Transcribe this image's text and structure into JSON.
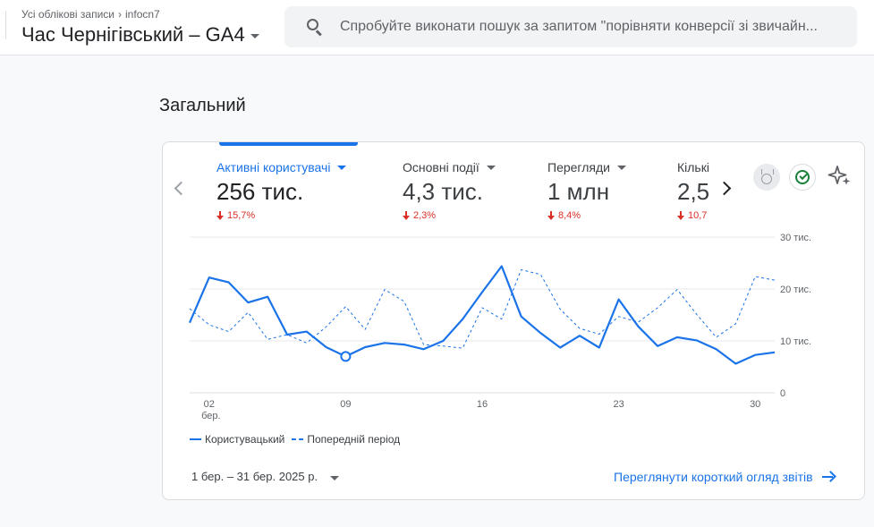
{
  "header": {
    "breadcrumb": [
      "Усі облікові записи",
      "infocn7"
    ],
    "property_name": "Час Чернігівський – GA4",
    "search_placeholder": "Спробуйте виконати пошук за запитом \"порівняти конверсії зі звичайн..."
  },
  "section_title": "Загальний",
  "metrics": [
    {
      "label": "Активні користувачі",
      "value": "256 тис.",
      "delta": "15,7%",
      "active": true
    },
    {
      "label": "Основні події",
      "value": "4,3 тис.",
      "delta": "2,3%",
      "active": false
    },
    {
      "label": "Перегляди",
      "value": "1 млн",
      "delta": "8,4%",
      "active": false
    },
    {
      "label": "Кількі",
      "value": "2,5",
      "delta": "10,7",
      "active": false
    }
  ],
  "icons": {
    "medal": "medal-icon",
    "check": "check-circle-icon",
    "sparkle": "sparkle-icon"
  },
  "colors": {
    "accent": "#1a73e8",
    "negative": "#d93025",
    "positive": "#188038"
  },
  "legend": {
    "current": "Користувацький",
    "previous": "Попередній період"
  },
  "date_range": "1 бер. – 31 бер. 2025 р.",
  "view_link": "Переглянути короткий огляд звітів",
  "chart_data": {
    "type": "line",
    "x": [
      1,
      2,
      3,
      4,
      5,
      6,
      7,
      8,
      9,
      10,
      11,
      12,
      13,
      14,
      15,
      16,
      17,
      18,
      19,
      20,
      21,
      22,
      23,
      24,
      25,
      26,
      27,
      28,
      29,
      30,
      31
    ],
    "x_ticks": [
      {
        "day": 2,
        "label": "02",
        "sub": "бер."
      },
      {
        "day": 9,
        "label": "09",
        "sub": ""
      },
      {
        "day": 16,
        "label": "16",
        "sub": ""
      },
      {
        "day": 23,
        "label": "23",
        "sub": ""
      },
      {
        "day": 30,
        "label": "30",
        "sub": ""
      }
    ],
    "y_ticks": [
      {
        "value": 0,
        "label": "0"
      },
      {
        "value": 10000,
        "label": "10 тис."
      },
      {
        "value": 20000,
        "label": "20 тис."
      },
      {
        "value": 30000,
        "label": "30 тис."
      }
    ],
    "ylim": [
      0,
      30000
    ],
    "series": [
      {
        "name": "Користувацький",
        "style": "solid",
        "values": [
          13500,
          22200,
          21300,
          17400,
          18500,
          11200,
          11800,
          8800,
          7000,
          8800,
          9600,
          9300,
          8400,
          10000,
          14200,
          19400,
          24400,
          14700,
          11500,
          8700,
          11000,
          8700,
          18000,
          12800,
          9000,
          10700,
          10100,
          8400,
          5600,
          7300,
          7800
        ]
      },
      {
        "name": "Попередній період",
        "style": "dashed",
        "values": [
          16200,
          13100,
          11800,
          15500,
          10300,
          11200,
          9600,
          12700,
          16600,
          12200,
          19900,
          17600,
          9300,
          9000,
          8600,
          16400,
          14200,
          23700,
          22800,
          16100,
          12400,
          11300,
          14700,
          13600,
          16400,
          19900,
          15100,
          10700,
          13300,
          22400,
          21700
        ]
      }
    ],
    "highlight": {
      "day": 9,
      "value": 7000
    }
  }
}
